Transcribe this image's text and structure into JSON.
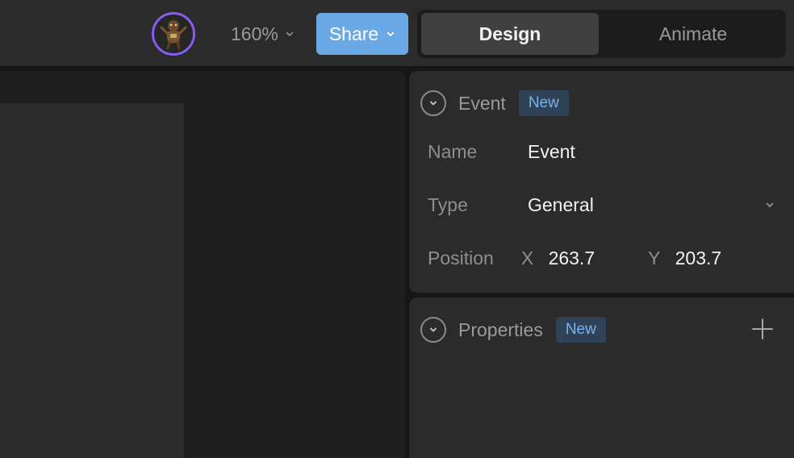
{
  "topbar": {
    "zoom": "160%",
    "share_label": "Share",
    "modes": [
      {
        "label": "Design",
        "active": true
      },
      {
        "label": "Animate",
        "active": false
      }
    ]
  },
  "event_panel": {
    "title": "Event",
    "badge": "New",
    "fields": {
      "name_label": "Name",
      "name_value": "Event",
      "type_label": "Type",
      "type_value": "General",
      "position_label": "Position",
      "x_label": "X",
      "x_value": "263.7",
      "y_label": "Y",
      "y_value": "203.7"
    }
  },
  "properties_panel": {
    "title": "Properties",
    "badge": "New"
  },
  "icons": {
    "avatar": "avatar-figure-icon",
    "chevron": "chevron-down-icon",
    "collapse": "collapse-circle-icon",
    "add": "plus-icon"
  },
  "colors": {
    "accent_share": "#6aa8e6",
    "avatar_ring": "#8a5cf0",
    "badge_bg": "#2f4257",
    "badge_text": "#78b2f0"
  }
}
